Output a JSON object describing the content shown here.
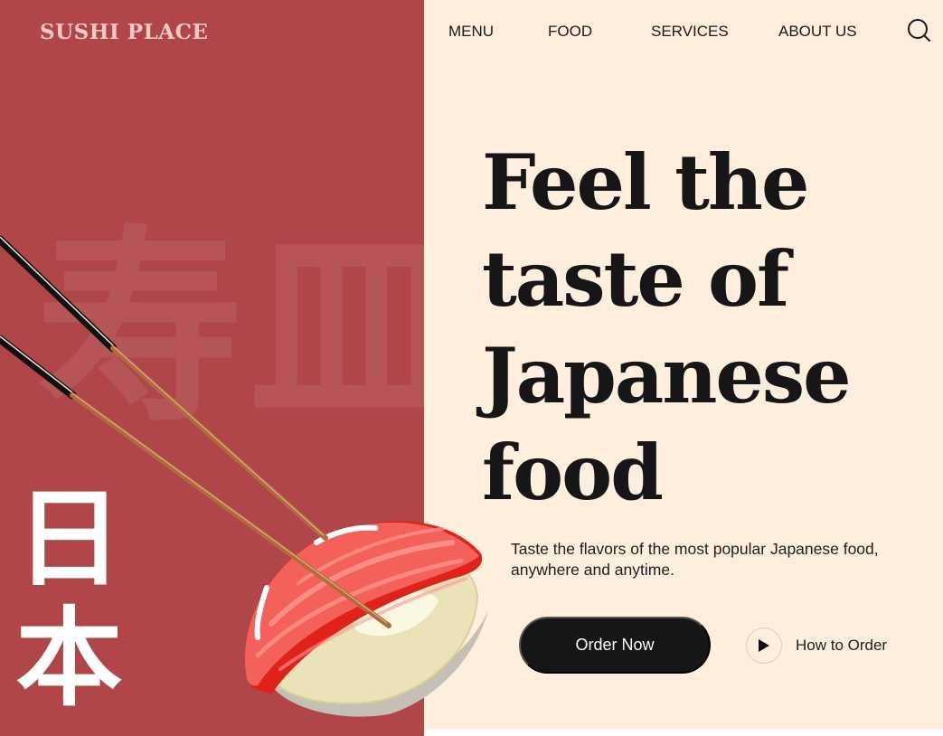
{
  "brand": {
    "logo_text": "SUSHI PLACE"
  },
  "nav": {
    "items": [
      {
        "label": "MENU"
      },
      {
        "label": "FOOD"
      },
      {
        "label": "SERVICES"
      },
      {
        "label": "ABOUT US"
      }
    ],
    "search_icon": "search-icon"
  },
  "hero": {
    "title_lines": [
      "Feel the",
      "taste of",
      "Japanese",
      "food"
    ],
    "subtitle": "Taste the flavors of the most popular Japanese food, anywhere and anytime.",
    "primary_cta": "Order Now",
    "secondary_cta": "How to Order",
    "secondary_icon": "play-icon"
  },
  "decor": {
    "background_kanji": "寿皿",
    "vertical_kanji": [
      "日",
      "本"
    ],
    "illustration": "sushi-with-chopsticks"
  },
  "colors": {
    "left_panel": "#b0464a",
    "right_panel": "#fdeedd",
    "logo": "#f6c7c7",
    "button": "#161616",
    "text": "#161616"
  }
}
